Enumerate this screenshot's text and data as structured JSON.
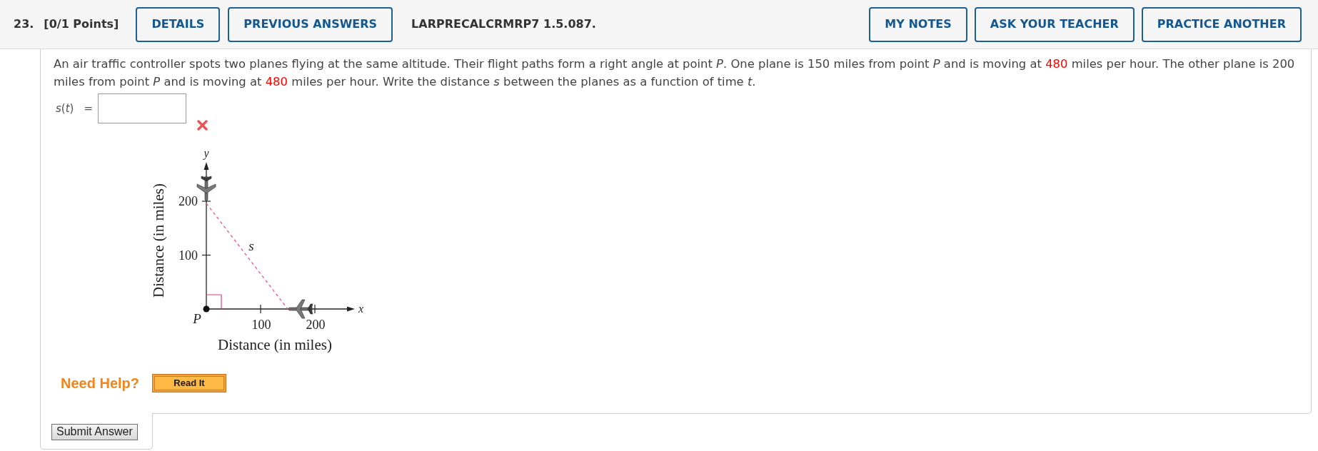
{
  "header": {
    "number": "23.",
    "points": "[0/1 Points]",
    "left_buttons": [
      "DETAILS",
      "PREVIOUS ANSWERS"
    ],
    "code": "LARPRECALCRMRP7 1.5.087.",
    "right_buttons": [
      "MY NOTES",
      "ASK YOUR TEACHER",
      "PRACTICE ANOTHER"
    ]
  },
  "question": {
    "segments": [
      {
        "kind": "text",
        "text": "An air traffic controller spots two planes flying at the same altitude. Their flight paths form a right angle at point *P*. One plane is 150 miles from point *P* and is moving at "
      },
      {
        "kind": "highlight",
        "text": "480"
      },
      {
        "kind": "text",
        "text": " miles per hour. The other plane is 200 miles from point *P* and is moving at "
      },
      {
        "kind": "highlight",
        "text": "480"
      },
      {
        "kind": "text",
        "text": " miles per hour. Write the distance *s* between the planes as a function of time *t*."
      }
    ]
  },
  "answer": {
    "label": "*s*(*t*)",
    "equals": "=",
    "incorrect": true
  },
  "figure": {
    "y_axis": "y",
    "y_ticks": [
      "200",
      "100"
    ],
    "y_title": "Distance (in miles)",
    "distance": "s",
    "x_axis": "x",
    "origin": "P",
    "x_ticks": [
      "100",
      "200"
    ],
    "x_title": "Distance (in miles)"
  },
  "help": {
    "label": "Need Help?",
    "buttons": [
      "Read It"
    ]
  },
  "submit": "Submit Answer"
}
